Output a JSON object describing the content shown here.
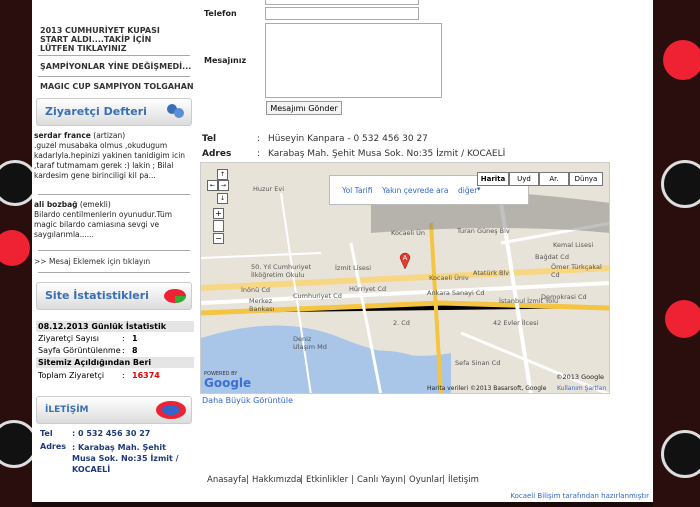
{
  "sidebar": {
    "news": [
      "2013 CUMHURİYET KUPASI START ALDI....TAKİP İÇİN LÜTFEN TIKLAYINIZ",
      "ŞAMPİYONLAR YİNE DEĞİŞMEDİ...",
      "MAGIC CUP ŞAMPİYON TOLGAHAN"
    ],
    "guestbook": {
      "title": "Ziyaretçi Defteri",
      "entries": [
        {
          "name": "serdar france",
          "tag": "(artizan)",
          "text": ".guzel musabaka olmus ,okudugum kadarlyla.hepinizi yakinen tanidigim icin ,taraf tutmamam gerek :) lakin ; Bilal kardesim gene birinciligi kil pa..."
        },
        {
          "name": "ali bozbağ",
          "tag": "(emekli)",
          "text": "Bilardo centilmenlerin oyunudur.Tüm magic bilardo camiasına sevgi ve saygılarımla......"
        }
      ],
      "add_link": ">> Mesaj Eklemek için tıklayın"
    },
    "stats": {
      "title": "Site İstatistikleri",
      "date_label": "08.12.2013 Günlük İstatistik",
      "rows": [
        {
          "label": "Ziyaretçi Sayısı",
          "sep": ":",
          "value": "1"
        },
        {
          "label": "Sayfa Görüntülenme",
          "sep": ":",
          "value": "8"
        }
      ],
      "since_label": "Sitemiz Açıldığından Beri",
      "total_label": "Toplam Ziyaretçi",
      "total_sep": ":",
      "total_value": "16374"
    },
    "contact": {
      "title": "İLETİŞİM",
      "tel_label": "Tel",
      "tel_value": ": 0 532 456 30 27",
      "addr_label": "Adres",
      "addr_value": ": Karabaş Mah. Şehit Musa Sok. No:35 İzmit / KOCAELİ"
    }
  },
  "form": {
    "phone_label": "Telefon",
    "message_label": "Mesajınız",
    "submit_label": "Mesajımı Gönder"
  },
  "info": {
    "tel_label": "Tel",
    "tel_value": "Hüseyin Kanpara - 0 532 456 30 27",
    "addr_label": "Adres",
    "addr_value": "Karabaş Mah. Şehit Musa Sok. No:35  İzmit / KOCAELİ",
    "sep": ":"
  },
  "map": {
    "popup_links": [
      "Yol Tarifi",
      "Yakın çevrede ara",
      "diğer"
    ],
    "types": [
      "Harita",
      "Uyd",
      "Ar.",
      "Dünya"
    ],
    "copyright": "Harita verileri ©2013 Basarsoft, Google",
    "terms": "Kullanım Şartları",
    "year": "©2013 Google",
    "powered": "POWERED BY",
    "logo": "Google",
    "marker": "A",
    "labels": [
      "Huzur Evi",
      "Kocaeli Ün",
      "Kocaeli Üniv",
      "İzmit Lisesi",
      "50. Yıl Cumhuriyet İlköğretim Okulu",
      "Merkez Bankası",
      "İnönü Cd",
      "Cumhuriyet Cd",
      "Hürriyet Cd",
      "Atatürk Blv",
      "Bağdat Cd",
      "Kemal Lisesi",
      "Ömer Türkçakal Cd",
      "İstanbul İzmit Yolu",
      "Demokrasi Cd",
      "42 Evler İlcesi",
      "Deniz Ulaşım Md",
      "2. Cd",
      "Sefa Sinan Cd",
      "Turan Güneş Blv",
      "Ankara Sanayi Cd"
    ]
  },
  "bigger_map": "Daha Büyük Görüntüle",
  "footer": {
    "nav": [
      "Anasayfa",
      "Hakkımızda",
      "Etkinlikler",
      "Canlı Yayın",
      "Oyunlar",
      "İletişim"
    ],
    "credit": "Kocaeli Bilişim tarafından hazırlanmıştır"
  }
}
